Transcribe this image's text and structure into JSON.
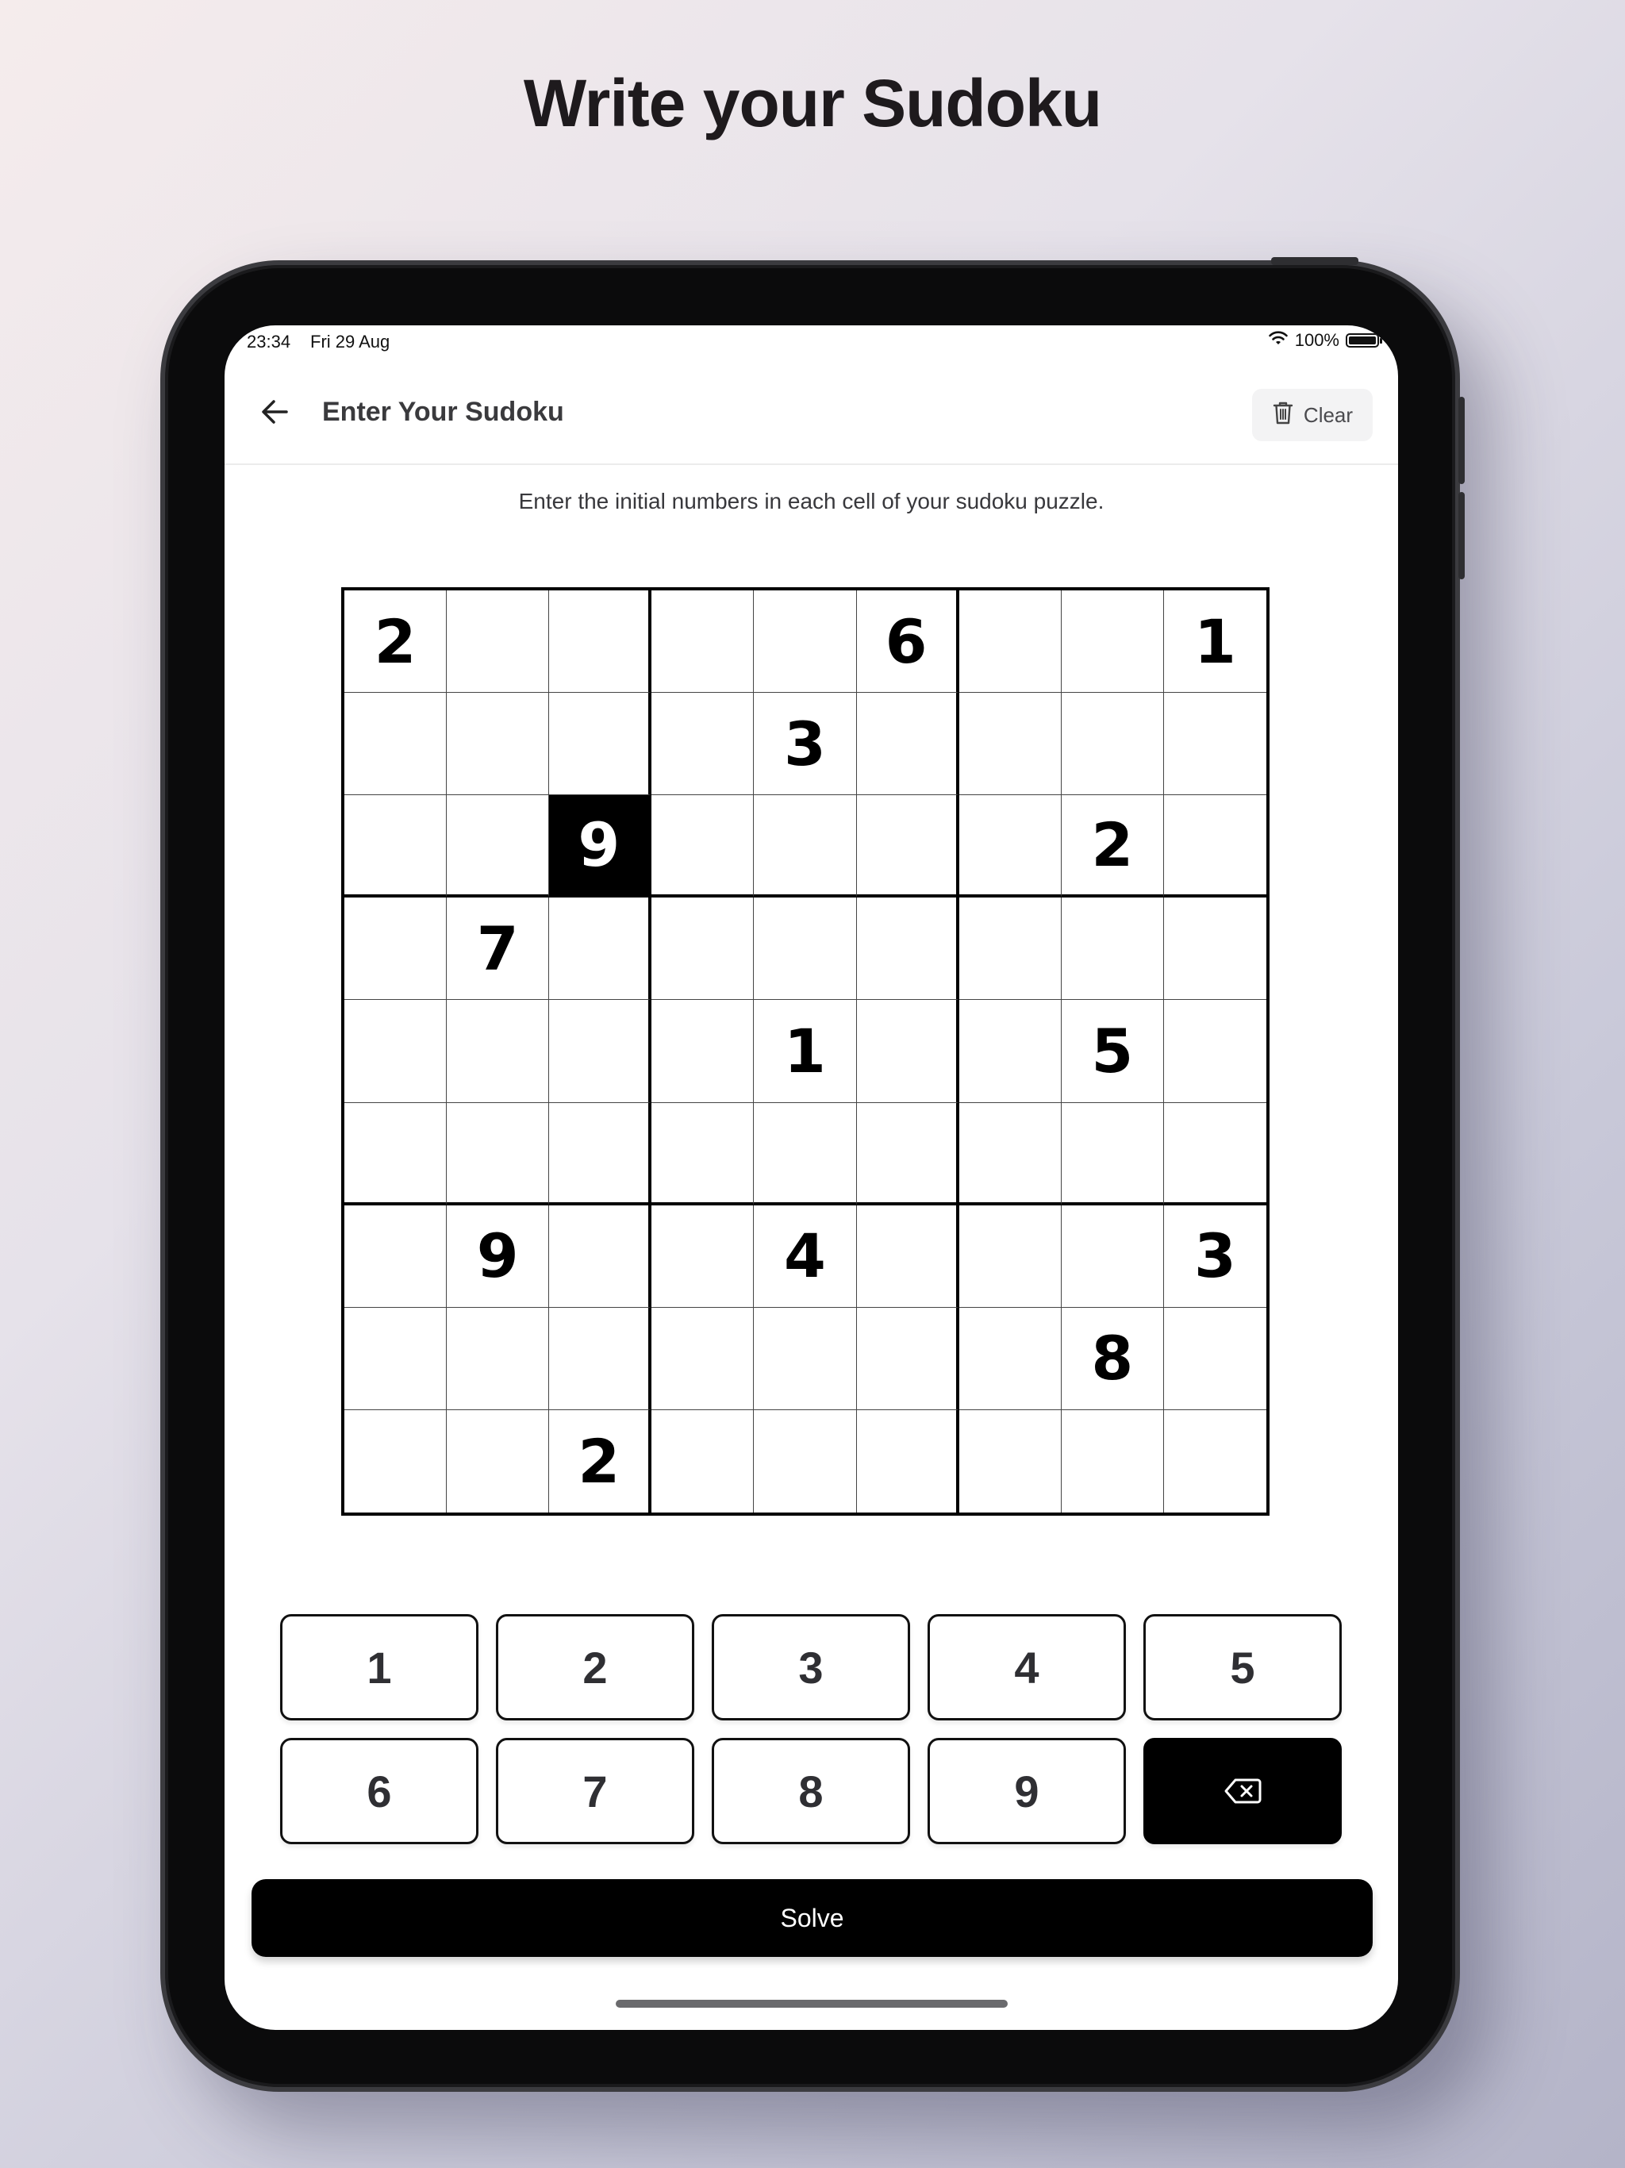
{
  "headline": "Write your Sudoku",
  "status_bar": {
    "time": "23:34",
    "date": "Fri 29 Aug",
    "battery": "100%",
    "battery_level": 1.0
  },
  "nav": {
    "title": "Enter Your Sudoku",
    "back_icon": "arrow-left-icon",
    "clear_label": "Clear",
    "clear_icon": "trash-icon"
  },
  "instructions": "Enter the initial numbers in each cell of your sudoku puzzle.",
  "grid": {
    "selected_row": 2,
    "selected_col": 2,
    "cells": [
      [
        "2",
        "",
        "",
        "",
        "",
        "6",
        "",
        "",
        "1"
      ],
      [
        "",
        "",
        "",
        "",
        "3",
        "",
        "",
        "",
        ""
      ],
      [
        "",
        "",
        "9",
        "",
        "",
        "",
        "",
        "2",
        ""
      ],
      [
        "",
        "7",
        "",
        "",
        "",
        "",
        "",
        "",
        ""
      ],
      [
        "",
        "",
        "",
        "",
        "1",
        "",
        "",
        "5",
        ""
      ],
      [
        "",
        "",
        "",
        "",
        "",
        "",
        "",
        "",
        ""
      ],
      [
        "",
        "9",
        "",
        "",
        "4",
        "",
        "",
        "",
        "3"
      ],
      [
        "",
        "",
        "",
        "",
        "",
        "",
        "",
        "8",
        ""
      ],
      [
        "",
        "",
        "2",
        "",
        "",
        "",
        "",
        "",
        ""
      ]
    ]
  },
  "keypad": {
    "keys": [
      "1",
      "2",
      "3",
      "4",
      "5",
      "6",
      "7",
      "8",
      "9"
    ],
    "delete_icon": "backspace-icon"
  },
  "solve_label": "Solve"
}
